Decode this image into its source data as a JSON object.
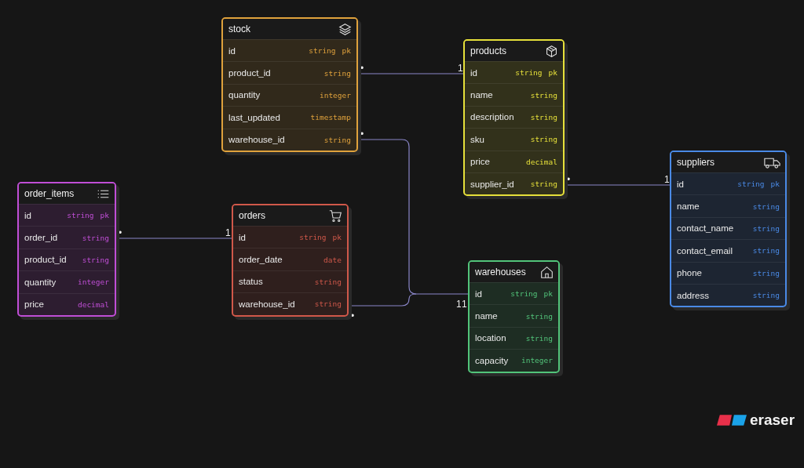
{
  "tables": [
    {
      "name": "stock",
      "kind": "layers",
      "color": "#e0a23c",
      "fields": [
        {
          "name": "id",
          "type": "string",
          "key": "pk"
        },
        {
          "name": "product_id",
          "type": "string"
        },
        {
          "name": "quantity",
          "type": "integer"
        },
        {
          "name": "last_updated",
          "type": "timestamp"
        },
        {
          "name": "warehouse_id",
          "type": "string"
        }
      ]
    },
    {
      "name": "products",
      "kind": "box",
      "color": "#e6e03a",
      "fields": [
        {
          "name": "id",
          "type": "string",
          "key": "pk"
        },
        {
          "name": "name",
          "type": "string"
        },
        {
          "name": "description",
          "type": "string"
        },
        {
          "name": "sku",
          "type": "string"
        },
        {
          "name": "price",
          "type": "decimal"
        },
        {
          "name": "supplier_id",
          "type": "string"
        }
      ]
    },
    {
      "name": "suppliers",
      "kind": "truck",
      "color": "#4a8ae6",
      "fields": [
        {
          "name": "id",
          "type": "string",
          "key": "pk"
        },
        {
          "name": "name",
          "type": "string"
        },
        {
          "name": "contact_name",
          "type": "string"
        },
        {
          "name": "contact_email",
          "type": "string"
        },
        {
          "name": "phone",
          "type": "string"
        },
        {
          "name": "address",
          "type": "string"
        }
      ]
    },
    {
      "name": "order_items",
      "kind": "list",
      "color": "#c04ed6",
      "fields": [
        {
          "name": "id",
          "type": "string",
          "key": "pk"
        },
        {
          "name": "order_id",
          "type": "string"
        },
        {
          "name": "product_id",
          "type": "string"
        },
        {
          "name": "quantity",
          "type": "integer"
        },
        {
          "name": "price",
          "type": "decimal"
        }
      ]
    },
    {
      "name": "orders",
      "kind": "cart",
      "color": "#d0584a",
      "fields": [
        {
          "name": "id",
          "type": "string",
          "key": "pk"
        },
        {
          "name": "order_date",
          "type": "date"
        },
        {
          "name": "status",
          "type": "string"
        },
        {
          "name": "warehouse_id",
          "type": "string"
        }
      ]
    },
    {
      "name": "warehouses",
      "kind": "house",
      "color": "#52c47a",
      "fields": [
        {
          "name": "id",
          "type": "string",
          "key": "pk"
        },
        {
          "name": "name",
          "type": "string"
        },
        {
          "name": "location",
          "type": "string"
        },
        {
          "name": "capacity",
          "type": "integer"
        }
      ]
    }
  ],
  "relations": [
    {
      "from_label": "•",
      "to_label": "1"
    },
    {
      "from_label": "•",
      "to_label": "1"
    },
    {
      "from_label": "•",
      "to_label": "1"
    },
    {
      "from_label": "•",
      "to_label": "1"
    },
    {
      "from_label": "•",
      "to_label": "1"
    }
  ],
  "logo": {
    "text": "eraser"
  }
}
